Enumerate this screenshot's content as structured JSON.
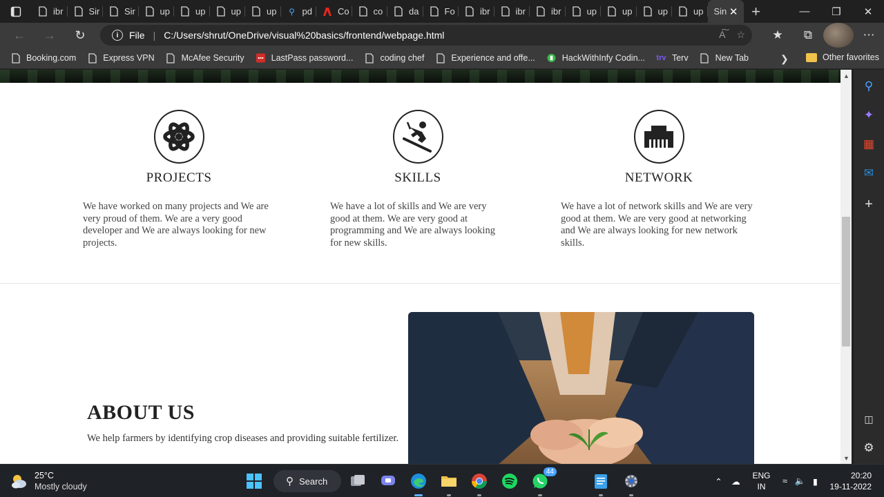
{
  "browser": {
    "tabs": [
      {
        "title": "ibr",
        "icon": "page-icon"
      },
      {
        "title": "Sir",
        "icon": "page-icon"
      },
      {
        "title": "Sir",
        "icon": "page-icon"
      },
      {
        "title": "up",
        "icon": "page-icon"
      },
      {
        "title": "up",
        "icon": "page-icon"
      },
      {
        "title": "up",
        "icon": "page-icon"
      },
      {
        "title": "up",
        "icon": "page-icon"
      },
      {
        "title": "pd",
        "icon": "search-icon"
      },
      {
        "title": "Co",
        "icon": "adobe-icon"
      },
      {
        "title": "co",
        "icon": "page-icon"
      },
      {
        "title": "da",
        "icon": "page-icon"
      },
      {
        "title": "Fo",
        "icon": "page-icon"
      },
      {
        "title": "ibr",
        "icon": "page-icon"
      },
      {
        "title": "ibr",
        "icon": "page-icon"
      },
      {
        "title": "ibr",
        "icon": "page-icon"
      },
      {
        "title": "up",
        "icon": "page-icon"
      },
      {
        "title": "up",
        "icon": "page-icon"
      },
      {
        "title": "up",
        "icon": "page-icon"
      },
      {
        "title": "up",
        "icon": "page-icon"
      }
    ],
    "active_tab": {
      "title": "Sin",
      "close_glyph": "✕"
    },
    "new_tab_glyph": "+",
    "address": {
      "scheme_label": "File",
      "url": "C:/Users/shrut/OneDrive/visual%20basics/frontend/webpage.html"
    },
    "favorites": [
      {
        "label": "Booking.com",
        "icon": "page-icon"
      },
      {
        "label": "Express VPN",
        "icon": "page-icon"
      },
      {
        "label": "McAfee Security",
        "icon": "page-icon"
      },
      {
        "label": "LastPass password...",
        "icon": "lastpass-icon"
      },
      {
        "label": "coding chef",
        "icon": "page-icon"
      },
      {
        "label": "Experience and offe...",
        "icon": "page-icon"
      },
      {
        "label": "HackWithInfy Codin...",
        "icon": "hackwithinfy-icon"
      },
      {
        "label": "Terv",
        "icon": "terv-icon"
      },
      {
        "label": "New Tab",
        "icon": "page-icon"
      }
    ],
    "other_favorites": "Other favorites",
    "colors": {
      "chrome": "#202020",
      "toolbar": "#3b3b3b",
      "omnibox": "#2a2a2a"
    }
  },
  "page": {
    "features": [
      {
        "title": "PROJECTS",
        "icon": "atom-icon",
        "text": "We have worked on many projects and We are very proud of them. We are a very good developer and We are always looking for new projects."
      },
      {
        "title": "SKILLS",
        "icon": "skier-icon",
        "text": "We have a lot of skills and We are very good at them. We are very good at programming and We are always looking for new skills."
      },
      {
        "title": "NETWORK",
        "icon": "network-port-icon",
        "text": "We have a lot of network skills and We are very good at them. We are very good at networking and We are always looking for new network skills."
      }
    ],
    "about": {
      "title": "ABOUT US",
      "text": "We help farmers by identifying crop diseases and providing suitable fertilizer."
    }
  },
  "taskbar": {
    "weather": {
      "temp": "25°C",
      "condition": "Mostly cloudy"
    },
    "search_label": "Search",
    "whatsapp_badge": "44",
    "language": {
      "line1": "ENG",
      "line2": "IN"
    },
    "clock": {
      "time": "20:20",
      "date": "19-11-2022"
    }
  }
}
